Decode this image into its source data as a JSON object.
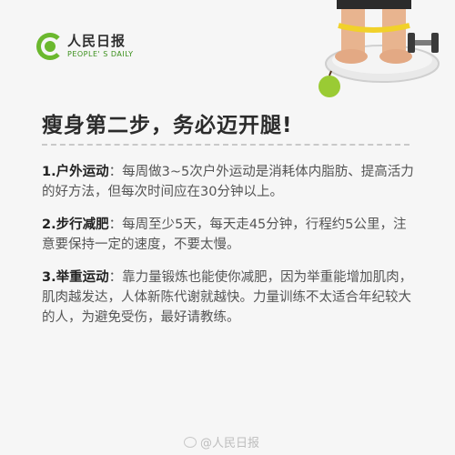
{
  "logo": {
    "name_cn": "人民日报",
    "name_en": "PEOPLE' S DAILY",
    "brand_color": "#6bb82e"
  },
  "illustration": {
    "icon": "feet-on-scale-with-dumbbell-and-apple-icon"
  },
  "title": "瘦身第二步，务必迈开腿!",
  "items": [
    {
      "head": "1.户外运动",
      "text": "：每周做3~5次户外运动是消耗体内脂肪、提高活力的好方法，但每次时间应在30分钟以上。"
    },
    {
      "head": "2.步行减肥",
      "text": "：每周至少5天，每天走45分钟，行程约5公里，注意要保持一定的速度，不要太慢。"
    },
    {
      "head": "3.举重运动",
      "text": "：靠力量锻炼也能使你减肥，因为举重能增加肌肉，肌肉越发达，人体新陈代谢就越快。力量训练不太适合年纪较大的人，为避免受伤，最好请教练。"
    }
  ],
  "watermark": "@人民日报"
}
